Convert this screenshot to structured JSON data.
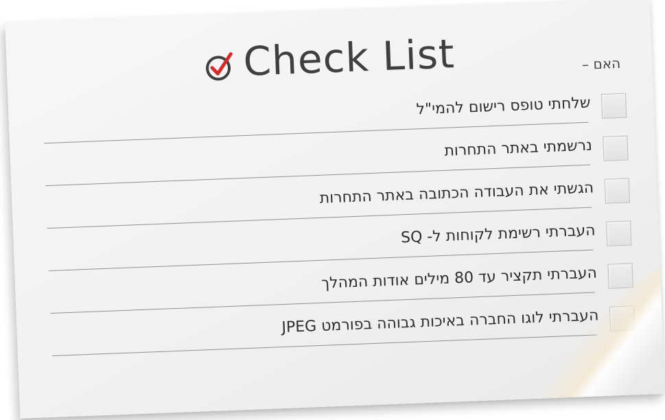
{
  "title": "Check List",
  "prefix": "האם –",
  "items": [
    {
      "label": "שלחתי טופס רישום להמי\"ל"
    },
    {
      "label": "נרשמתי באתר התחרות"
    },
    {
      "label": "הגשתי את העבודה הכתובה באתר התחרות"
    },
    {
      "label": "העברתי רשימת לקוחות ל- SQ"
    },
    {
      "label": "העברתי תקציר עד 80 מילים אודות המהלך"
    },
    {
      "label": "העברתי לוגו החברה באיכות גבוהה בפורמט JPEG"
    }
  ],
  "icons": {
    "title_icon": "checkmark-circle-icon"
  },
  "colors": {
    "accent": "#d42a2a",
    "title": "#3f3f3f"
  }
}
